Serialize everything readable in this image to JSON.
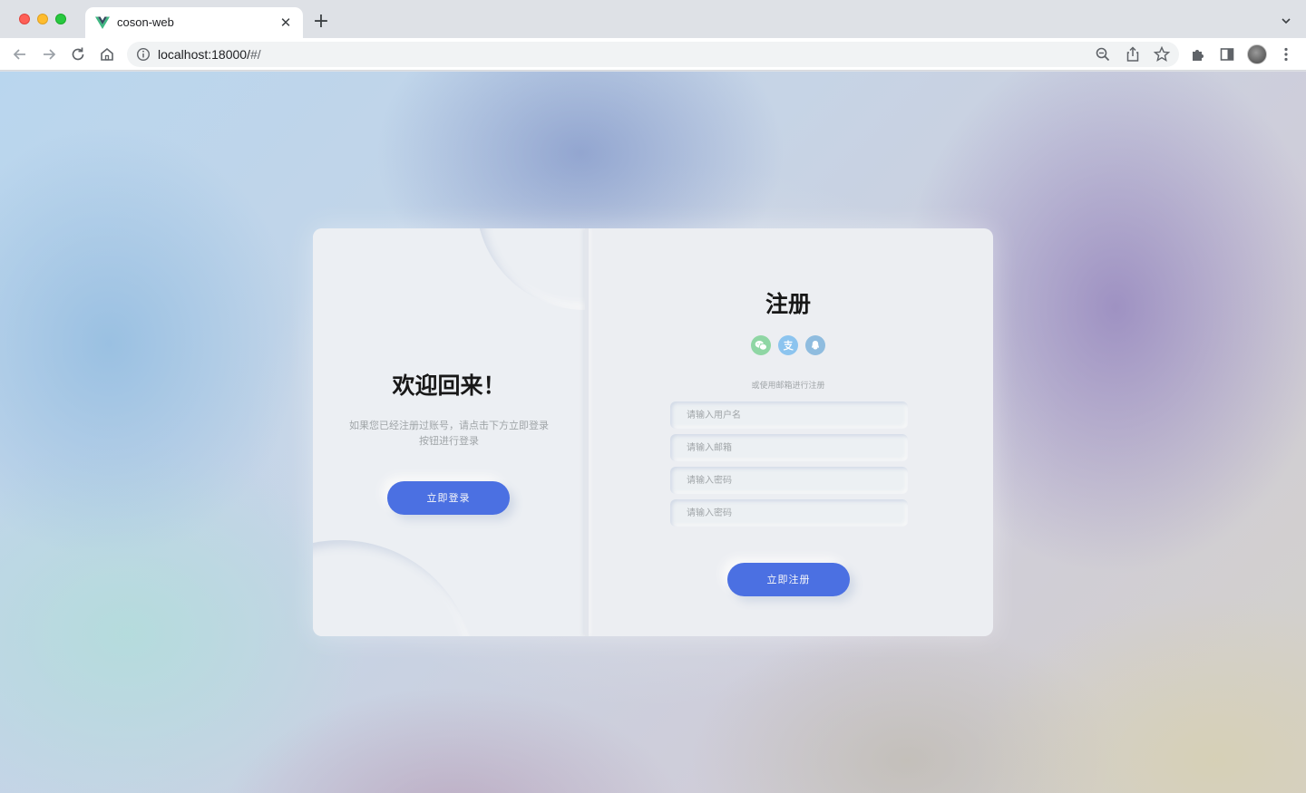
{
  "browser": {
    "tab_title": "coson-web",
    "tab_close": "✕",
    "new_tab": "+",
    "url_host": "localhost:18000/",
    "url_path": "#/"
  },
  "login_panel": {
    "title": "欢迎回来！",
    "description": "如果您已经注册过账号，请点击下方立即登录按钮进行登录",
    "login_button": "立即登录"
  },
  "register_panel": {
    "title": "注册",
    "social_icons": [
      "wechat-icon",
      "alipay-icon",
      "qq-icon"
    ],
    "hint": "或使用邮箱进行注册",
    "fields": [
      {
        "placeholder": "请输入用户名"
      },
      {
        "placeholder": "请输入邮箱"
      },
      {
        "placeholder": "请输入密码"
      },
      {
        "placeholder": "请输入密码"
      }
    ],
    "register_button": "立即注册"
  },
  "colors": {
    "accent": "#4b70e2",
    "card": "#eceef2",
    "text_muted": "#a0a5a8"
  }
}
